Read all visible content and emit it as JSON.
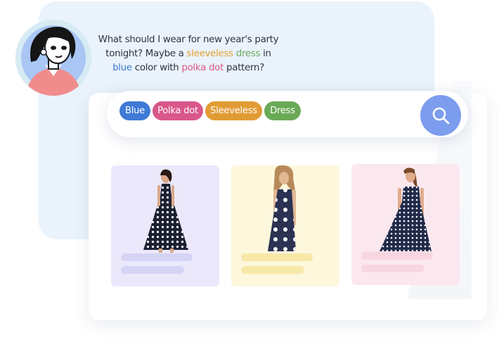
{
  "query": {
    "line1": "What should I wear for new year's party",
    "line2_prefix": "tonight? Maybe a ",
    "kw_sleeveless": "sleeveless",
    "kw_dress": "dress",
    "line2_suffix": " in",
    "kw_blue": "blue",
    "line3_mid": " color with ",
    "kw_polka": "polka dot",
    "line3_suffix": " pattern?"
  },
  "chips": {
    "blue": "Blue",
    "polka_dot": "Polka dot",
    "sleeveless": "Sleeveless",
    "dress": "Dress"
  },
  "search_button": {
    "icon": "search-icon"
  },
  "products": [
    {
      "background": "#ece8fb",
      "dress_color": "#1d2233",
      "dot_color": "#ffffff"
    },
    {
      "background": "#fdf7dc",
      "dress_color": "#2b3252",
      "dot_color": "#ffffff"
    },
    {
      "background": "#fbe8ef",
      "dress_color": "#222a4a",
      "dot_color": "#ffffff"
    }
  ],
  "colors": {
    "chip_blue": "#3f7ad6",
    "chip_pink": "#d9578a",
    "chip_orange": "#e19b35",
    "chip_green": "#6aa956",
    "search_button": "#7c9cee",
    "chat_bubble": "#eaf3fb"
  }
}
